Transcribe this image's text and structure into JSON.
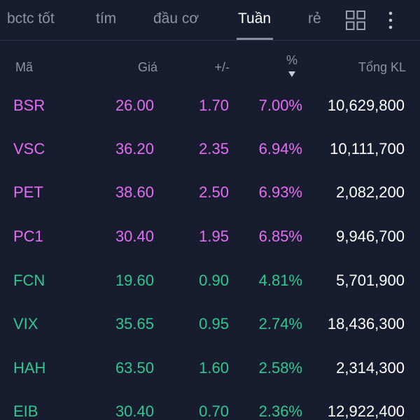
{
  "tabs": [
    {
      "label": "bctc tốt"
    },
    {
      "label": "tím"
    },
    {
      "label": "đầu cơ"
    },
    {
      "label": "Tuần"
    },
    {
      "label": "rẻ"
    }
  ],
  "active_tab": "Tuần",
  "icons": {
    "grid": "grid-view-icon",
    "more": "more-vertical-icon"
  },
  "columns": {
    "symbol": "Mã",
    "price": "Giá",
    "change": "+/-",
    "percent": "%",
    "volume": "Tổng KL"
  },
  "sort": {
    "column": "percent",
    "direction": "descending"
  },
  "colors": {
    "background": "#171c2e",
    "ceiling_purple": "#e36ef3",
    "up_green": "#33c78f",
    "volume_white": "#ffffff",
    "muted": "#8e93a3"
  },
  "rows": [
    {
      "symbol": "BSR",
      "price": "26.00",
      "change": "1.70",
      "percent": "7.00%",
      "volume": "10,629,800",
      "color": "#e36ef3"
    },
    {
      "symbol": "VSC",
      "price": "36.20",
      "change": "2.35",
      "percent": "6.94%",
      "volume": "10,111,700",
      "color": "#e36ef3"
    },
    {
      "symbol": "PET",
      "price": "38.60",
      "change": "2.50",
      "percent": "6.93%",
      "volume": "2,082,200",
      "color": "#e36ef3"
    },
    {
      "symbol": "PC1",
      "price": "30.40",
      "change": "1.95",
      "percent": "6.85%",
      "volume": "9,946,700",
      "color": "#e36ef3"
    },
    {
      "symbol": "FCN",
      "price": "19.60",
      "change": "0.90",
      "percent": "4.81%",
      "volume": "5,701,900",
      "color": "#33c78f"
    },
    {
      "symbol": "VIX",
      "price": "35.65",
      "change": "0.95",
      "percent": "2.74%",
      "volume": "18,436,300",
      "color": "#33c78f"
    },
    {
      "symbol": "HAH",
      "price": "63.50",
      "change": "1.60",
      "percent": "2.58%",
      "volume": "2,314,300",
      "color": "#33c78f"
    },
    {
      "symbol": "EIB",
      "price": "30.40",
      "change": "0.70",
      "percent": "2.36%",
      "volume": "12,922,400",
      "color": "#33c78f"
    }
  ]
}
